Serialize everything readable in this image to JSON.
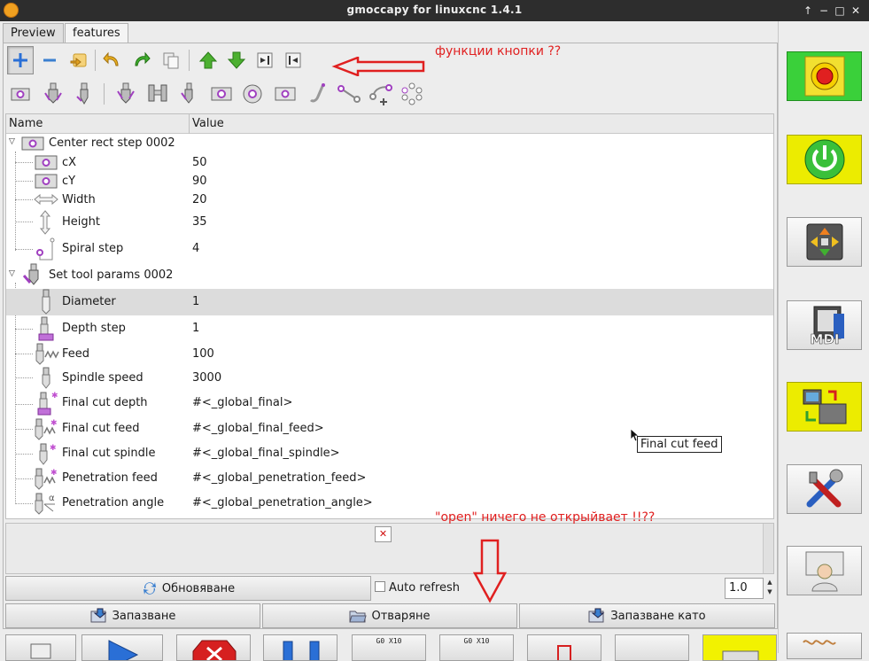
{
  "window": {
    "title": "gmoccapy for linuxcnc   1.4.1",
    "controls": [
      "↑",
      "−",
      "□",
      "✕"
    ]
  },
  "tabs": [
    {
      "label": "Preview",
      "active": false
    },
    {
      "label": "features",
      "active": true
    }
  ],
  "toolbar_main": [
    {
      "icon": "add-icon",
      "pressed": true
    },
    {
      "icon": "remove-icon"
    },
    {
      "icon": "duplicate-icon"
    },
    {
      "icon": "undo-icon"
    },
    {
      "icon": "redo-icon"
    },
    {
      "icon": "copy-icon"
    },
    {
      "icon": "move-up-icon"
    },
    {
      "icon": "move-down-icon"
    },
    {
      "icon": "indent-icon"
    },
    {
      "icon": "unindent-icon"
    }
  ],
  "toolbar_features": [
    "rect-pocket-icon",
    "mill-icon",
    "drill-icon",
    "mill-group-icon",
    "mill-pair-icon",
    "mill-small-icon",
    "rect-center-icon",
    "circle-icon",
    "rect-outline-icon",
    "probe-icon",
    "line-icon",
    "arc-add-icon",
    "circle-pattern-icon"
  ],
  "annotations": {
    "top": "функции кнопки ??",
    "bottom": "\"open\" ничего не открыйвает !!??"
  },
  "tree": {
    "columns": {
      "name": "Name",
      "value": "Value"
    },
    "groups": [
      {
        "name": "Center rect step 0002",
        "icon": "rect-center-icon",
        "items": [
          {
            "name": "cX",
            "value": "50",
            "icon": "rect-center-icon"
          },
          {
            "name": "cY",
            "value": "90",
            "icon": "rect-center-icon"
          },
          {
            "name": "Width",
            "value": "20",
            "icon": "width-arrow-icon"
          },
          {
            "name": "Height",
            "value": "35",
            "icon": "height-arrow-icon"
          },
          {
            "name": "Spiral step",
            "value": "4",
            "icon": "spiral-step-icon"
          }
        ]
      },
      {
        "name": "Set tool params 0002",
        "icon": "tool-params-icon",
        "items": [
          {
            "name": "Diameter",
            "value": "1",
            "icon": "diameter-icon",
            "selected": true
          },
          {
            "name": "Depth step",
            "value": "1",
            "icon": "depth-step-icon"
          },
          {
            "name": "Feed",
            "value": "100",
            "icon": "feed-icon"
          },
          {
            "name": "Spindle speed",
            "value": "3000",
            "icon": "spindle-icon"
          },
          {
            "name": "Final cut depth",
            "value": "#<_global_final>",
            "icon": "final-depth-icon"
          },
          {
            "name": "Final cut feed",
            "value": "#<_global_final_feed>",
            "icon": "final-feed-icon"
          },
          {
            "name": "Final cut spindle",
            "value": "#<_global_final_spindle>",
            "icon": "final-spindle-icon"
          },
          {
            "name": "Penetration feed",
            "value": "#<_global_penetration_feed>",
            "icon": "penetration-feed-icon"
          },
          {
            "name": "Penetration angle",
            "value": "#<_global_penetration_angle>",
            "icon": "penetration-angle-icon"
          }
        ]
      }
    ]
  },
  "tooltip": "Final cut feed",
  "controls": {
    "refresh": "Обновяване",
    "auto_refresh": "Auto refresh",
    "auto_refresh_checked": false,
    "scale": "1.0",
    "save": "Запазване",
    "open": "Отваряне",
    "save_as": "Запазване като"
  },
  "bottom_toolbar": [
    {
      "icon": "manual-icon"
    },
    {
      "icon": "auto-run-icon"
    },
    {
      "icon": "stop-icon"
    },
    {
      "icon": "pause-icon"
    },
    {
      "icon": "g0-x10-icon",
      "text": "G0 X10"
    },
    {
      "icon": "g0-x10-alt-icon",
      "text": "G0 X10"
    },
    {
      "icon": "exit-icon"
    },
    {
      "icon": "blank-icon"
    },
    {
      "icon": "highlight-icon",
      "highlighted": true
    }
  ],
  "sidebar": [
    {
      "name": "emergency-stop-button",
      "icon": "emergency-stop-icon",
      "state": "green"
    },
    {
      "name": "machine-power-button",
      "icon": "power-icon",
      "state": "yellow"
    },
    {
      "name": "manual-mode-button",
      "icon": "jog-arrows-icon"
    },
    {
      "name": "mdi-mode-button",
      "icon": "mdi-icon",
      "label": "MDI"
    },
    {
      "name": "auto-mode-button",
      "icon": "auto-mode-icon",
      "state": "yellow"
    },
    {
      "name": "settings-button",
      "icon": "tools-icon"
    },
    {
      "name": "user-tabs-button",
      "icon": "user-icon"
    },
    {
      "name": "bottom-side-button",
      "icon": "spring-icon"
    }
  ]
}
